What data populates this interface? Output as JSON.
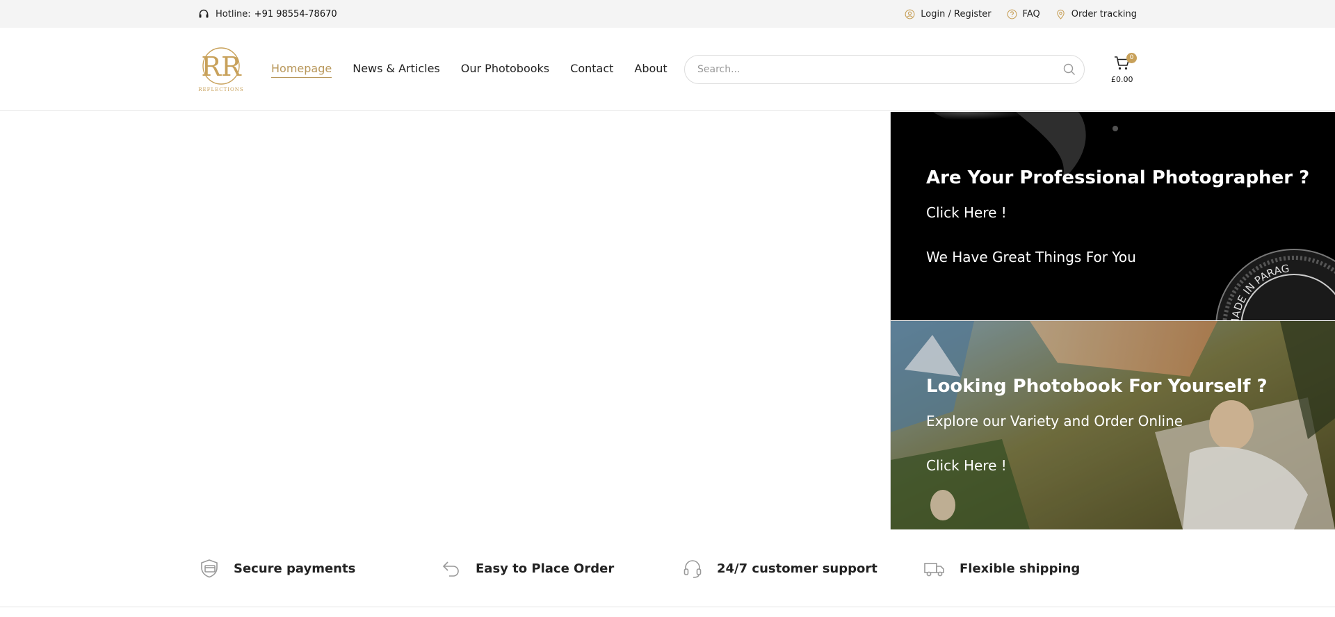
{
  "topbar": {
    "hotline_label": "Hotline:",
    "hotline_number": "+91 98554-78670",
    "links": [
      {
        "label": "Login / Register",
        "icon": "user-circle-icon"
      },
      {
        "label": "FAQ",
        "icon": "question-circle-icon"
      },
      {
        "label": "Order tracking",
        "icon": "map-pin-icon"
      }
    ]
  },
  "header": {
    "logo_text": "REFLECTIONS",
    "nav": [
      {
        "label": "Homepage",
        "active": true
      },
      {
        "label": "News & Articles"
      },
      {
        "label": "Our Photobooks"
      },
      {
        "label": "Contact"
      },
      {
        "label": "About"
      }
    ],
    "search": {
      "placeholder": "Search...",
      "value": ""
    },
    "cart": {
      "count": "0",
      "total": "£0.00"
    }
  },
  "banners": [
    {
      "title": "Are Your Professional Photographer ?",
      "lines": [
        "Click Here !",
        "We Have Great Things For You"
      ],
      "stamp_text": "MADE IN PARAG"
    },
    {
      "title": "Looking Photobook For Yourself ?",
      "lines": [
        "Explore our Variety and Order Online",
        "Click Here !"
      ]
    }
  ],
  "features": [
    {
      "label": "Secure payments",
      "icon": "shield-card-icon"
    },
    {
      "label": "Easy to Place Order",
      "icon": "undo-arrow-icon"
    },
    {
      "label": "24/7 customer support",
      "icon": "headset-icon"
    },
    {
      "label": "Flexible shipping",
      "icon": "truck-icon"
    }
  ],
  "colors": {
    "accent": "#b8975a",
    "badge": "#c8a15a",
    "topbar_bg": "#f4f4f4"
  }
}
